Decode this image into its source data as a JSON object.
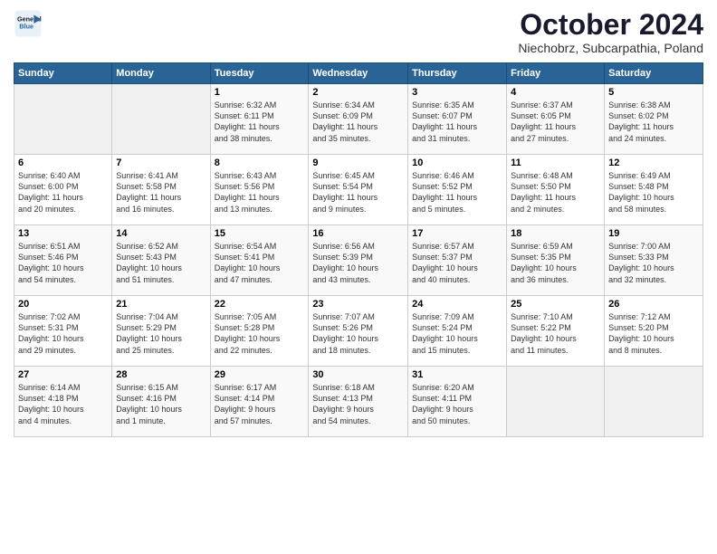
{
  "header": {
    "logo_line1": "General",
    "logo_line2": "Blue",
    "month_title": "October 2024",
    "subtitle": "Niechobrz, Subcarpathia, Poland"
  },
  "weekdays": [
    "Sunday",
    "Monday",
    "Tuesday",
    "Wednesday",
    "Thursday",
    "Friday",
    "Saturday"
  ],
  "weeks": [
    [
      {
        "day": "",
        "info": ""
      },
      {
        "day": "",
        "info": ""
      },
      {
        "day": "1",
        "info": "Sunrise: 6:32 AM\nSunset: 6:11 PM\nDaylight: 11 hours\nand 38 minutes."
      },
      {
        "day": "2",
        "info": "Sunrise: 6:34 AM\nSunset: 6:09 PM\nDaylight: 11 hours\nand 35 minutes."
      },
      {
        "day": "3",
        "info": "Sunrise: 6:35 AM\nSunset: 6:07 PM\nDaylight: 11 hours\nand 31 minutes."
      },
      {
        "day": "4",
        "info": "Sunrise: 6:37 AM\nSunset: 6:05 PM\nDaylight: 11 hours\nand 27 minutes."
      },
      {
        "day": "5",
        "info": "Sunrise: 6:38 AM\nSunset: 6:02 PM\nDaylight: 11 hours\nand 24 minutes."
      }
    ],
    [
      {
        "day": "6",
        "info": "Sunrise: 6:40 AM\nSunset: 6:00 PM\nDaylight: 11 hours\nand 20 minutes."
      },
      {
        "day": "7",
        "info": "Sunrise: 6:41 AM\nSunset: 5:58 PM\nDaylight: 11 hours\nand 16 minutes."
      },
      {
        "day": "8",
        "info": "Sunrise: 6:43 AM\nSunset: 5:56 PM\nDaylight: 11 hours\nand 13 minutes."
      },
      {
        "day": "9",
        "info": "Sunrise: 6:45 AM\nSunset: 5:54 PM\nDaylight: 11 hours\nand 9 minutes."
      },
      {
        "day": "10",
        "info": "Sunrise: 6:46 AM\nSunset: 5:52 PM\nDaylight: 11 hours\nand 5 minutes."
      },
      {
        "day": "11",
        "info": "Sunrise: 6:48 AM\nSunset: 5:50 PM\nDaylight: 11 hours\nand 2 minutes."
      },
      {
        "day": "12",
        "info": "Sunrise: 6:49 AM\nSunset: 5:48 PM\nDaylight: 10 hours\nand 58 minutes."
      }
    ],
    [
      {
        "day": "13",
        "info": "Sunrise: 6:51 AM\nSunset: 5:46 PM\nDaylight: 10 hours\nand 54 minutes."
      },
      {
        "day": "14",
        "info": "Sunrise: 6:52 AM\nSunset: 5:43 PM\nDaylight: 10 hours\nand 51 minutes."
      },
      {
        "day": "15",
        "info": "Sunrise: 6:54 AM\nSunset: 5:41 PM\nDaylight: 10 hours\nand 47 minutes."
      },
      {
        "day": "16",
        "info": "Sunrise: 6:56 AM\nSunset: 5:39 PM\nDaylight: 10 hours\nand 43 minutes."
      },
      {
        "day": "17",
        "info": "Sunrise: 6:57 AM\nSunset: 5:37 PM\nDaylight: 10 hours\nand 40 minutes."
      },
      {
        "day": "18",
        "info": "Sunrise: 6:59 AM\nSunset: 5:35 PM\nDaylight: 10 hours\nand 36 minutes."
      },
      {
        "day": "19",
        "info": "Sunrise: 7:00 AM\nSunset: 5:33 PM\nDaylight: 10 hours\nand 32 minutes."
      }
    ],
    [
      {
        "day": "20",
        "info": "Sunrise: 7:02 AM\nSunset: 5:31 PM\nDaylight: 10 hours\nand 29 minutes."
      },
      {
        "day": "21",
        "info": "Sunrise: 7:04 AM\nSunset: 5:29 PM\nDaylight: 10 hours\nand 25 minutes."
      },
      {
        "day": "22",
        "info": "Sunrise: 7:05 AM\nSunset: 5:28 PM\nDaylight: 10 hours\nand 22 minutes."
      },
      {
        "day": "23",
        "info": "Sunrise: 7:07 AM\nSunset: 5:26 PM\nDaylight: 10 hours\nand 18 minutes."
      },
      {
        "day": "24",
        "info": "Sunrise: 7:09 AM\nSunset: 5:24 PM\nDaylight: 10 hours\nand 15 minutes."
      },
      {
        "day": "25",
        "info": "Sunrise: 7:10 AM\nSunset: 5:22 PM\nDaylight: 10 hours\nand 11 minutes."
      },
      {
        "day": "26",
        "info": "Sunrise: 7:12 AM\nSunset: 5:20 PM\nDaylight: 10 hours\nand 8 minutes."
      }
    ],
    [
      {
        "day": "27",
        "info": "Sunrise: 6:14 AM\nSunset: 4:18 PM\nDaylight: 10 hours\nand 4 minutes."
      },
      {
        "day": "28",
        "info": "Sunrise: 6:15 AM\nSunset: 4:16 PM\nDaylight: 10 hours\nand 1 minute."
      },
      {
        "day": "29",
        "info": "Sunrise: 6:17 AM\nSunset: 4:14 PM\nDaylight: 9 hours\nand 57 minutes."
      },
      {
        "day": "30",
        "info": "Sunrise: 6:18 AM\nSunset: 4:13 PM\nDaylight: 9 hours\nand 54 minutes."
      },
      {
        "day": "31",
        "info": "Sunrise: 6:20 AM\nSunset: 4:11 PM\nDaylight: 9 hours\nand 50 minutes."
      },
      {
        "day": "",
        "info": ""
      },
      {
        "day": "",
        "info": ""
      }
    ]
  ]
}
